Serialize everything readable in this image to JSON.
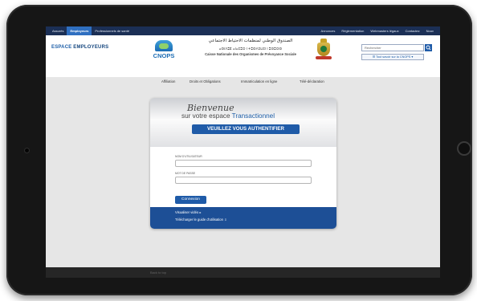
{
  "topnav": {
    "left": [
      "Assurés",
      "Employeurs",
      "Professionnels de santé"
    ],
    "active_index": 1,
    "right": [
      "Annonces",
      "Réglementation",
      "Webmasters légaux",
      "Contactez",
      "Nouv"
    ]
  },
  "header": {
    "espace_prefix": "ESPACE ",
    "espace_title": "EMPLOYEURS",
    "logo_text": "CNOPS",
    "name_ar": "الصندوق الوطني لمنظمات الاحتياط الاجتماعي",
    "name_tifinagh": "ⴰⵙⵏⴷⵓⵇ ⴰⵏⴰⵎⵓⵔ ⵏ ⵜⵓⵙⴷⵉⵡⵉⵏ ⵏ ⵓⵙⵓⵔⵙ",
    "name_fr": "Caisse Nationale des Organismes de Prévoyance Sociale",
    "search_placeholder": "Rechercher",
    "tout_savoir": "Tout savoir sur la CNOPS"
  },
  "nav": {
    "items": [
      "Affiliation",
      "Droits et Obligations",
      "Immatriculation en ligne",
      "Télé-déclaration"
    ]
  },
  "login": {
    "bienvenue": "Bienvenue",
    "sur_votre": "sur votre espace ",
    "transactionnel": "Transactionnel",
    "auth_banner": "VEUILLEZ VOUS AUTHENTIFIER",
    "username_label": "NOM D'UTILISATEUR",
    "password_label": "MOT DE PASSE",
    "connexion": "Connexion",
    "link1": "Visualiser vidéo",
    "link2": "Télécharger le guide d'utilisation"
  },
  "footer": {
    "text": "Back to top"
  },
  "colors": {
    "topbar": "#1b2f55",
    "accent": "#1f5ba8",
    "bezel": "#161616"
  }
}
